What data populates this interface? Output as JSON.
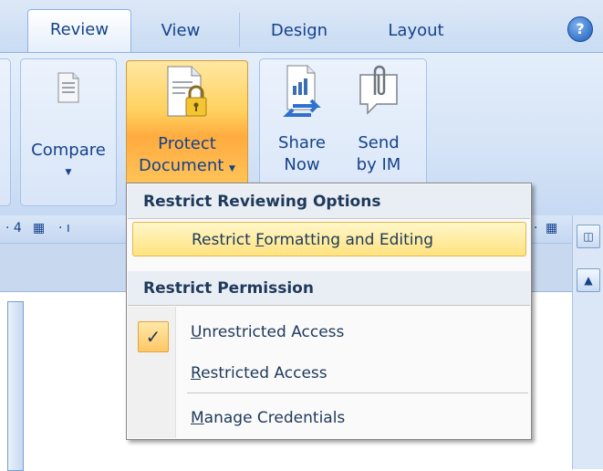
{
  "tabs": [
    {
      "label": "Review",
      "active": true
    },
    {
      "label": "View",
      "active": false
    },
    {
      "label": "Design",
      "active": false
    },
    {
      "label": "Layout",
      "active": false
    }
  ],
  "help": {
    "glyph": "?"
  },
  "ribbon": {
    "compare": {
      "label": "Compare",
      "icon": "document-icon"
    },
    "protect": {
      "line1": "Protect",
      "line2": "Document",
      "icon": "lock-document-icon"
    },
    "share": {
      "line1": "Share",
      "line2": "Now",
      "icon": "share-document-icon"
    },
    "send": {
      "line1": "Send",
      "line2": "by IM",
      "icon": "paperclip-speech-icon"
    }
  },
  "ruler": {
    "left_text": "· 4",
    "mid_text": "· ı"
  },
  "menu": {
    "section1": "Restrict Reviewing Options",
    "item_formatting": {
      "before": "Restrict ",
      "accel": "F",
      "after": "ormatting and Editing"
    },
    "section2": "Restrict Permission",
    "item_unrestricted": {
      "accel": "U",
      "after": "nrestricted Access",
      "checked": true
    },
    "item_restricted": {
      "accel": "R",
      "after": "estricted Access"
    },
    "item_manage": {
      "accel": "M",
      "after": "anage Credentials"
    },
    "check_glyph": "✓"
  },
  "colors": {
    "highlight": "#ffe37f",
    "text": "#15428b",
    "menu_text": "#1e395b"
  }
}
